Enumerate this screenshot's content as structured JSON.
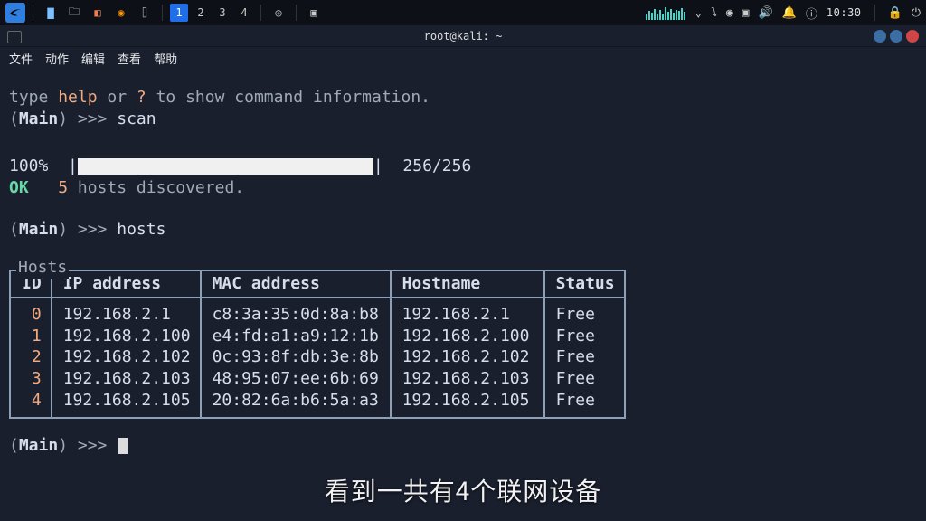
{
  "panel": {
    "workspaces": [
      "1",
      "2",
      "3",
      "4"
    ],
    "active_workspace": 0,
    "clock": "10:30"
  },
  "titlebar": {
    "icon_label": "terminal-icon",
    "title": "root@kali: ~"
  },
  "menubar": {
    "items": [
      "文件",
      "动作",
      "编辑",
      "查看",
      "帮助"
    ]
  },
  "terminal": {
    "line_help_pre": "type ",
    "line_help_h": "help",
    "line_help_or": " or ",
    "line_help_q": "?",
    "line_help_post": " to show command information.",
    "prompt_open": "(",
    "prompt_main": "Main",
    "prompt_close": ") >>> ",
    "cmd_scan": "scan",
    "progress_pct": "100%",
    "progress_pipe_l": "|",
    "progress_pipe_r": "|",
    "progress_count": "256/256",
    "scan_ok": "OK",
    "scan_hosts_n": "5",
    "scan_hosts_txt": " hosts discovered.",
    "cmd_hosts": "hosts",
    "hosts_legend": "Hosts",
    "columns": [
      "ID",
      "IP address",
      "MAC address",
      "Hostname",
      "Status"
    ],
    "rows": [
      {
        "id": "0",
        "ip": "192.168.2.1",
        "mac": "c8:3a:35:0d:8a:b8",
        "host": "192.168.2.1",
        "status": "Free"
      },
      {
        "id": "1",
        "ip": "192.168.2.100",
        "mac": "e4:fd:a1:a9:12:1b",
        "host": "192.168.2.100",
        "status": "Free"
      },
      {
        "id": "2",
        "ip": "192.168.2.102",
        "mac": "0c:93:8f:db:3e:8b",
        "host": "192.168.2.102",
        "status": "Free"
      },
      {
        "id": "3",
        "ip": "192.168.2.103",
        "mac": "48:95:07:ee:6b:69",
        "host": "192.168.2.103",
        "status": "Free"
      },
      {
        "id": "4",
        "ip": "192.168.2.105",
        "mac": "20:82:6a:b6:5a:a3",
        "host": "192.168.2.105",
        "status": "Free"
      }
    ]
  },
  "caption": "看到一共有4个联网设备"
}
